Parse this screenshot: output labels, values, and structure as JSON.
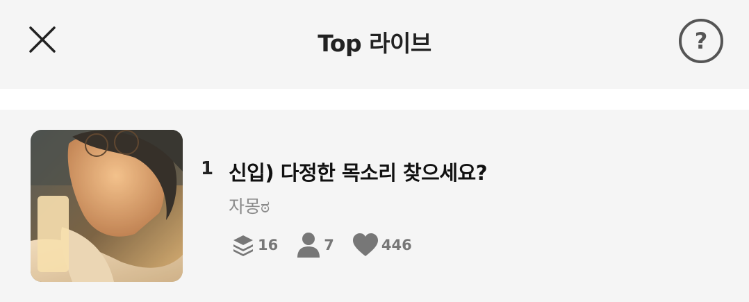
{
  "header": {
    "title": "Top 라이브",
    "close_icon": "close-icon",
    "help_icon": "help-icon",
    "help_glyph": "?"
  },
  "item": {
    "rank": "1",
    "title": "신입) 다정한 목소리 찾으세요?",
    "author": "자몽ಠ",
    "thumbnail": "thumbnail-image",
    "stats": {
      "layers_icon": "layers-icon",
      "layers": "16",
      "listeners_icon": "person-icon",
      "listeners": "7",
      "likes_icon": "heart-icon",
      "likes": "446"
    }
  }
}
